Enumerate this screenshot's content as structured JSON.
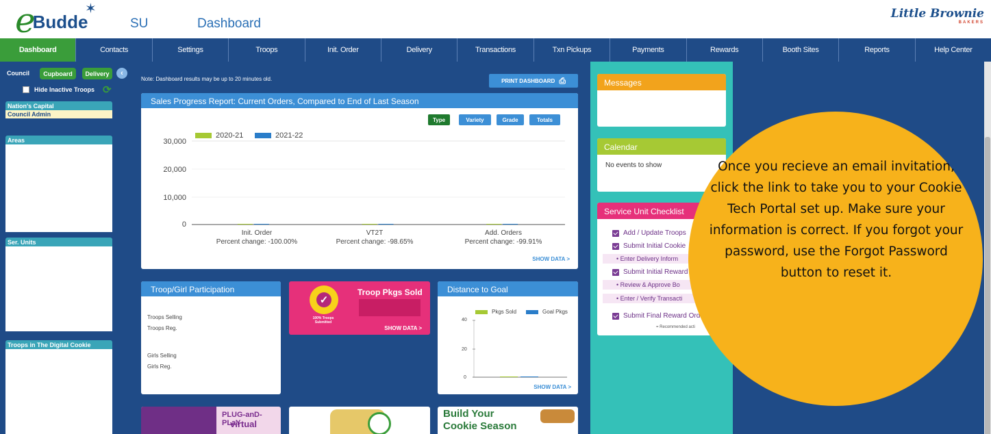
{
  "header": {
    "logo_e": "e",
    "logo_word": "Budde",
    "unit": "SU",
    "title": "Dashboard",
    "brand_main": "Little Brownie",
    "brand_sub": "BAKERS"
  },
  "nav": [
    {
      "label": "Dashboard",
      "active": true
    },
    {
      "label": "Contacts"
    },
    {
      "label": "Settings"
    },
    {
      "label": "Troops"
    },
    {
      "label": "Init. Order"
    },
    {
      "label": "Delivery"
    },
    {
      "label": "Transactions"
    },
    {
      "label": "Txn Pickups"
    },
    {
      "label": "Payments"
    },
    {
      "label": "Rewards"
    },
    {
      "label": "Booth Sites"
    },
    {
      "label": "Reports"
    },
    {
      "label": "Help Center"
    }
  ],
  "left": {
    "council": "Council",
    "cupboard": "Cupboard",
    "delivery": "Delivery",
    "hide_inactive": "Hide Inactive Troops",
    "panels": {
      "nations_capital": "Nation's Capital",
      "council_admin": "Council Admin",
      "areas": "Areas",
      "ser_units": "Ser. Units",
      "troops_digital": "Troops in The Digital Cookie"
    }
  },
  "center": {
    "note": "Note: Dashboard results may be up to 20 minutes old.",
    "print_label": "PRINT DASHBOARD",
    "sales": {
      "title": "Sales Progress Report: Current Orders, Compared to End of Last Season",
      "buttons": [
        "Type",
        "Variety",
        "Grade",
        "Totals"
      ],
      "show_data": "SHOW DATA >"
    },
    "participation": {
      "title": "Troop/Girl Participation",
      "troops_selling": "Troops Selling",
      "troops_reg": "Troops Reg.",
      "girls_selling": "Girls Selling",
      "girls_reg": "Girls Reg."
    },
    "pkgs_sold": {
      "title": "Troop Pkgs Sold",
      "badge": "100% Troops Submitted",
      "show_data": "SHOW DATA >"
    },
    "distance": {
      "title": "Distance to Goal",
      "show_data": "SHOW DATA >"
    },
    "banners": {
      "plug_line1": "PLUG-anD-PLaY",
      "plug_line2": "virtual",
      "build_line1": "Build Your",
      "build_line2": "Cookie Season"
    }
  },
  "right": {
    "messages": "Messages",
    "calendar": "Calendar",
    "calendar_empty": "No events to show",
    "checklist_title": "Service Unit Checklist",
    "checklist": [
      {
        "text": "Add / Update Troops",
        "kind": "check"
      },
      {
        "text": "Submit Initial Cookie",
        "kind": "check"
      },
      {
        "text": "Enter Delivery Inform",
        "kind": "bullet"
      },
      {
        "text": "Submit Initial Reward",
        "kind": "check"
      },
      {
        "text": "Review & Approve Bo",
        "kind": "bullet"
      },
      {
        "text": "Enter / Verify Transacti",
        "kind": "bullet"
      },
      {
        "text": "Submit Final Reward Ord",
        "kind": "check"
      }
    ],
    "recommended": "= Recommended acti"
  },
  "overlay": {
    "text": "Once you recieve an email invitation, click the link to take you to your Cookie Tech Portal set up. Make sure your information is correct. If you forgot your password, use the Forgot Password button to reset it."
  },
  "chart_data": [
    {
      "type": "bar",
      "categories": [
        "Init. Order",
        "VT2T",
        "Add. Orders"
      ],
      "category_notes": [
        "Percent change: -100.00%",
        "Percent change: -98.65%",
        "Percent change: -99.91%"
      ],
      "series": [
        {
          "name": "2020-21",
          "values": [
            0,
            0,
            0
          ],
          "color": "#a6c934"
        },
        {
          "name": "2021-22",
          "values": [
            0,
            0,
            0
          ],
          "color": "#2a7dc9"
        }
      ],
      "yticks": [
        "30,000",
        "20,000",
        "10,000",
        "0"
      ],
      "ylim": [
        0,
        30000
      ],
      "legend": "top-left"
    },
    {
      "type": "bar",
      "series": [
        {
          "name": "Pkgs Sold",
          "values": [
            0
          ],
          "color": "#a6c934"
        },
        {
          "name": "Goal Pkgs",
          "values": [
            0
          ],
          "color": "#2a7dc9"
        }
      ],
      "yticks": [
        "40",
        "20",
        "0"
      ],
      "ylim": [
        0,
        40
      ],
      "legend": "top-right"
    }
  ]
}
